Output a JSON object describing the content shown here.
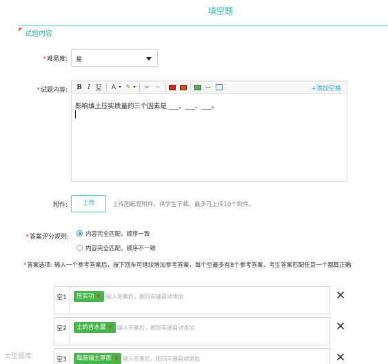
{
  "page_title": "填空题",
  "section": {
    "title": "试题内容"
  },
  "difficulty": {
    "label": "难易度:",
    "value": "易"
  },
  "question": {
    "label": "试题内容:",
    "toolbar": {
      "bold": "B",
      "italic": "I",
      "underline": "U",
      "font_color": "A",
      "add_blank": "+添加空格"
    },
    "content": "影响填土压实质量的三个因素是 ___、___、___。"
  },
  "attachment": {
    "label": "附件:",
    "upload_button": "上传",
    "hint": "上传图纸等附件，供学生下载。最多可上传10个附件。"
  },
  "scoring": {
    "label": "答案评分规则:",
    "options": [
      {
        "label": "内容完全匹配，顺序一致",
        "checked": true
      },
      {
        "label": "内容完全匹配，顺序不一致",
        "checked": false
      }
    ]
  },
  "answer_options": {
    "label": "答案选项:",
    "description": "输入一个参考答案后，按下回车可继续增加参考答案，每个空最多有8个参考答案，考生答案匹配任意一个都算正确"
  },
  "blanks": [
    {
      "number": "空1",
      "tag": "压实功",
      "placeholder": "输入答案后，按回车键自动添加"
    },
    {
      "number": "空2",
      "tag": "土的含水量",
      "placeholder": "输入答案后，按回车键自动添加"
    },
    {
      "number": "空3",
      "tag": "每层铺土厚度",
      "placeholder": "输入答案后，按回车键自动添加"
    }
  ],
  "watermark": "大型题库"
}
